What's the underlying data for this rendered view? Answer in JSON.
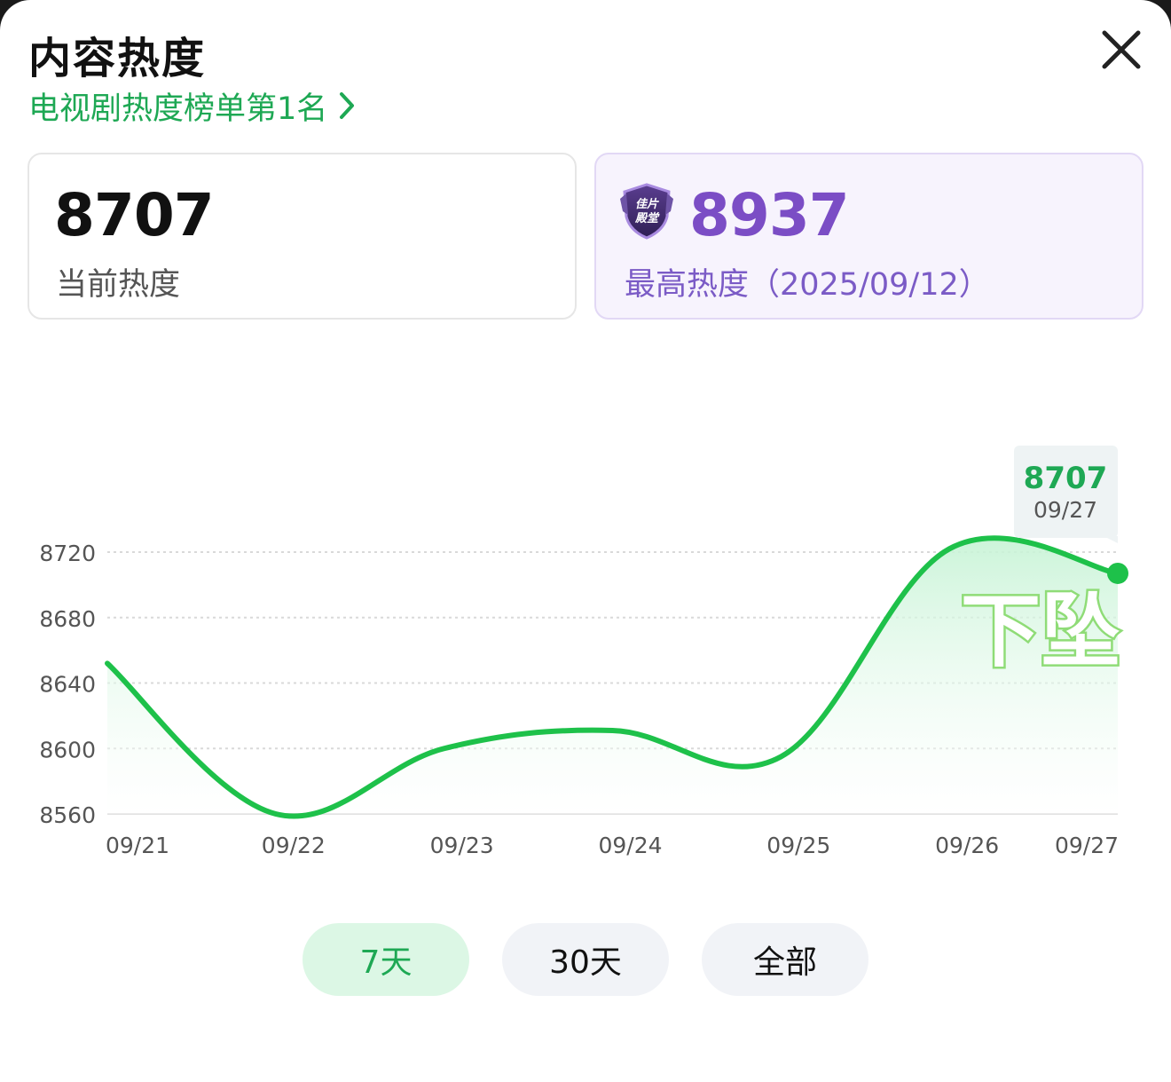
{
  "header": {
    "title": "内容热度",
    "rank_link": "电视剧热度榜单第1名"
  },
  "cards": {
    "current": {
      "value": "8707",
      "label": "当前热度"
    },
    "peak": {
      "value": "8937",
      "label": "最高热度（2025/09/12）",
      "badge_text": "佳片殿堂"
    }
  },
  "chart_data": {
    "type": "area",
    "x": [
      "09/21",
      "09/22",
      "09/23",
      "09/24",
      "09/25",
      "09/26",
      "09/27"
    ],
    "y_ticks": [
      8720,
      8680,
      8640,
      8600,
      8560
    ],
    "ylim": [
      8560,
      8730
    ],
    "series": [
      {
        "values": [
          8652,
          8560,
          8600,
          8611,
          8595,
          8722,
          8707
        ]
      }
    ],
    "tooltip": {
      "value": "8707",
      "date": "09/27"
    },
    "annotation": "下坠",
    "grid": true,
    "colors": {
      "line": "#1ec14a",
      "annotation": "#8fdc77",
      "axis_text": "#555555"
    }
  },
  "tabs": [
    {
      "label": "7天",
      "active": true
    },
    {
      "label": "30天",
      "active": false
    },
    {
      "label": "全部",
      "active": false
    }
  ],
  "colors": {
    "accent": "#1ea854",
    "purple": "#7b4dc5"
  }
}
